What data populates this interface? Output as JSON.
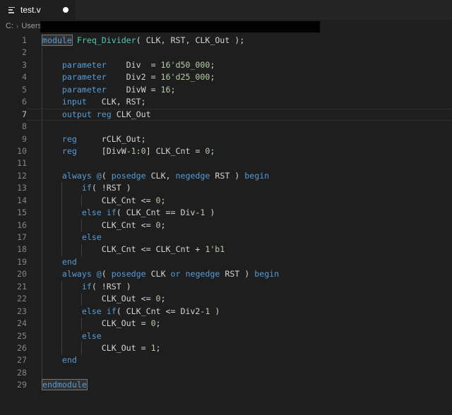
{
  "tab": {
    "title": "test.v",
    "modified": true,
    "icon": "file-lines-icon"
  },
  "breadcrumb": {
    "segments": [
      "C:",
      "Users"
    ],
    "separator": "›",
    "redacted_path": true
  },
  "colors": {
    "background": "#1e1e1e",
    "tab_strip": "#252526",
    "keyword": "#569cd6",
    "type_name": "#4ec9b0",
    "number": "#b5cea8",
    "text": "#d4d4d4",
    "line_number": "#858585",
    "active_line_number": "#c6c6c6",
    "indent_guide": "#404040"
  },
  "editor": {
    "language": "verilog",
    "active_line": 7,
    "word_highlights": [
      "module",
      "endmodule"
    ],
    "guides": [
      {
        "col": 0,
        "from": 2,
        "to": 28
      },
      {
        "col": 4,
        "from": 13,
        "to": 18
      },
      {
        "col": 8,
        "from": 14,
        "to": 14
      },
      {
        "col": 8,
        "from": 16,
        "to": 16
      },
      {
        "col": 8,
        "from": 18,
        "to": 18
      },
      {
        "col": 4,
        "from": 21,
        "to": 26
      },
      {
        "col": 8,
        "from": 22,
        "to": 22
      },
      {
        "col": 8,
        "from": 24,
        "to": 24
      },
      {
        "col": 8,
        "from": 26,
        "to": 26
      }
    ],
    "lines": [
      {
        "num": 1,
        "tokens": [
          [
            "module",
            "kwbox"
          ],
          [
            " ",
            "plain"
          ],
          [
            "Freq_Divider",
            "type"
          ],
          [
            "( CLK, RST, CLK_Out );",
            "plain"
          ]
        ]
      },
      {
        "num": 2,
        "tokens": []
      },
      {
        "num": 3,
        "tokens": [
          [
            "    ",
            "plain"
          ],
          [
            "parameter",
            "kw"
          ],
          [
            "    Div  = ",
            "plain"
          ],
          [
            "16'd50_000",
            "num"
          ],
          [
            ";",
            "plain"
          ]
        ]
      },
      {
        "num": 4,
        "tokens": [
          [
            "    ",
            "plain"
          ],
          [
            "parameter",
            "kw"
          ],
          [
            "    Div2 = ",
            "plain"
          ],
          [
            "16'd25_000",
            "num"
          ],
          [
            ";",
            "plain"
          ]
        ]
      },
      {
        "num": 5,
        "tokens": [
          [
            "    ",
            "plain"
          ],
          [
            "parameter",
            "kw"
          ],
          [
            "    DivW = ",
            "plain"
          ],
          [
            "16",
            "num"
          ],
          [
            ";",
            "plain"
          ]
        ]
      },
      {
        "num": 6,
        "tokens": [
          [
            "    ",
            "plain"
          ],
          [
            "input",
            "kw"
          ],
          [
            "   CLK, RST;",
            "plain"
          ]
        ]
      },
      {
        "num": 7,
        "tokens": [
          [
            "    ",
            "plain"
          ],
          [
            "output",
            "kw"
          ],
          [
            " ",
            "plain"
          ],
          [
            "reg",
            "kw"
          ],
          [
            " CLK_Out",
            "plain"
          ]
        ]
      },
      {
        "num": 8,
        "tokens": []
      },
      {
        "num": 9,
        "tokens": [
          [
            "    ",
            "plain"
          ],
          [
            "reg",
            "kw"
          ],
          [
            "     rCLK_Out;",
            "plain"
          ]
        ]
      },
      {
        "num": 10,
        "tokens": [
          [
            "    ",
            "plain"
          ],
          [
            "reg",
            "kw"
          ],
          [
            "     [DivW-",
            "plain"
          ],
          [
            "1",
            "num"
          ],
          [
            ":",
            "plain"
          ],
          [
            "0",
            "num"
          ],
          [
            "] CLK_Cnt = ",
            "plain"
          ],
          [
            "0",
            "num"
          ],
          [
            ";",
            "plain"
          ]
        ]
      },
      {
        "num": 11,
        "tokens": []
      },
      {
        "num": 12,
        "tokens": [
          [
            "    ",
            "plain"
          ],
          [
            "always",
            "kw"
          ],
          [
            " ",
            "plain"
          ],
          [
            "@",
            "kw"
          ],
          [
            "( ",
            "plain"
          ],
          [
            "posedge",
            "kw"
          ],
          [
            " CLK, ",
            "plain"
          ],
          [
            "negedge",
            "kw"
          ],
          [
            " RST ) ",
            "plain"
          ],
          [
            "begin",
            "kw"
          ]
        ]
      },
      {
        "num": 13,
        "tokens": [
          [
            "        ",
            "plain"
          ],
          [
            "if",
            "kw"
          ],
          [
            "( !RST )",
            "plain"
          ]
        ]
      },
      {
        "num": 14,
        "tokens": [
          [
            "            CLK_Cnt <= ",
            "plain"
          ],
          [
            "0",
            "num"
          ],
          [
            ";",
            "plain"
          ]
        ]
      },
      {
        "num": 15,
        "tokens": [
          [
            "        ",
            "plain"
          ],
          [
            "else",
            "kw"
          ],
          [
            " ",
            "plain"
          ],
          [
            "if",
            "kw"
          ],
          [
            "( CLK_Cnt == Div-",
            "plain"
          ],
          [
            "1",
            "num"
          ],
          [
            " )",
            "plain"
          ]
        ]
      },
      {
        "num": 16,
        "tokens": [
          [
            "            CLK_Cnt <= ",
            "plain"
          ],
          [
            "0",
            "num"
          ],
          [
            ";",
            "plain"
          ]
        ]
      },
      {
        "num": 17,
        "tokens": [
          [
            "        ",
            "plain"
          ],
          [
            "else",
            "kw"
          ]
        ]
      },
      {
        "num": 18,
        "tokens": [
          [
            "            CLK_Cnt <= CLK_Cnt + ",
            "plain"
          ],
          [
            "1'b1",
            "num"
          ]
        ]
      },
      {
        "num": 19,
        "tokens": [
          [
            "    ",
            "plain"
          ],
          [
            "end",
            "kw"
          ]
        ]
      },
      {
        "num": 20,
        "tokens": [
          [
            "    ",
            "plain"
          ],
          [
            "always",
            "kw"
          ],
          [
            " ",
            "plain"
          ],
          [
            "@",
            "kw"
          ],
          [
            "( ",
            "plain"
          ],
          [
            "posedge",
            "kw"
          ],
          [
            " CLK ",
            "plain"
          ],
          [
            "or",
            "kw"
          ],
          [
            " ",
            "plain"
          ],
          [
            "negedge",
            "kw"
          ],
          [
            " RST ) ",
            "plain"
          ],
          [
            "begin",
            "kw"
          ]
        ]
      },
      {
        "num": 21,
        "tokens": [
          [
            "        ",
            "plain"
          ],
          [
            "if",
            "kw"
          ],
          [
            "( !RST )",
            "plain"
          ]
        ]
      },
      {
        "num": 22,
        "tokens": [
          [
            "            CLK_Out <= ",
            "plain"
          ],
          [
            "0",
            "num"
          ],
          [
            ";",
            "plain"
          ]
        ]
      },
      {
        "num": 23,
        "tokens": [
          [
            "        ",
            "plain"
          ],
          [
            "else",
            "kw"
          ],
          [
            " ",
            "plain"
          ],
          [
            "if",
            "kw"
          ],
          [
            "( CLK_Cnt <= Div2-",
            "plain"
          ],
          [
            "1",
            "num"
          ],
          [
            " )",
            "plain"
          ]
        ]
      },
      {
        "num": 24,
        "tokens": [
          [
            "            CLK_Out = ",
            "plain"
          ],
          [
            "0",
            "num"
          ],
          [
            ";",
            "plain"
          ]
        ]
      },
      {
        "num": 25,
        "tokens": [
          [
            "        ",
            "plain"
          ],
          [
            "else",
            "kw"
          ]
        ]
      },
      {
        "num": 26,
        "tokens": [
          [
            "            CLK_Out = ",
            "plain"
          ],
          [
            "1",
            "num"
          ],
          [
            ";",
            "plain"
          ]
        ]
      },
      {
        "num": 27,
        "tokens": [
          [
            "    ",
            "plain"
          ],
          [
            "end",
            "kw"
          ]
        ]
      },
      {
        "num": 28,
        "tokens": []
      },
      {
        "num": 29,
        "tokens": [
          [
            "endmodule",
            "kwbox"
          ]
        ]
      }
    ]
  }
}
